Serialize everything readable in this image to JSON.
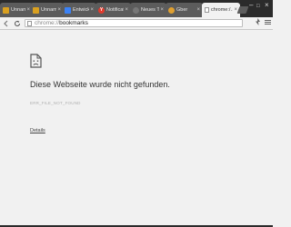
{
  "tabs": [
    {
      "title": "Unnam…",
      "favicon_color": "#d9a020",
      "favicon_glyph": "",
      "active": false
    },
    {
      "title": "Unnam…",
      "favicon_color": "#d9a020",
      "favicon_glyph": "",
      "active": false
    },
    {
      "title": "Entwickl…",
      "favicon_color": "#3b82f6",
      "favicon_glyph": "",
      "active": false
    },
    {
      "title": "Notificat…",
      "favicon_color": "#e23b2e",
      "favicon_glyph": "Y",
      "active": false
    },
    {
      "title": "Neues T…",
      "favicon_color": "#777777",
      "favicon_glyph": "",
      "active": false
    },
    {
      "title": "Gber",
      "favicon_color": "#e0a030",
      "favicon_glyph": "",
      "active": false
    },
    {
      "title": "chrome:/…",
      "favicon_color": "#888888",
      "favicon_glyph": "",
      "active": true
    }
  ],
  "toolbar": {
    "url_scheme": "chrome://",
    "url_path": "bookmarks"
  },
  "error_page": {
    "heading": "Diese Webseite wurde nicht gefunden.",
    "code": "ERR_FILE_NOT_FOUND",
    "details_link": "Details"
  },
  "colors": {
    "tabstrip_bg": "#2b2b2b",
    "inactive_tab": "#5c5c5c",
    "active_tab": "#f2f2f2",
    "page_bg": "#f1f1f1"
  }
}
